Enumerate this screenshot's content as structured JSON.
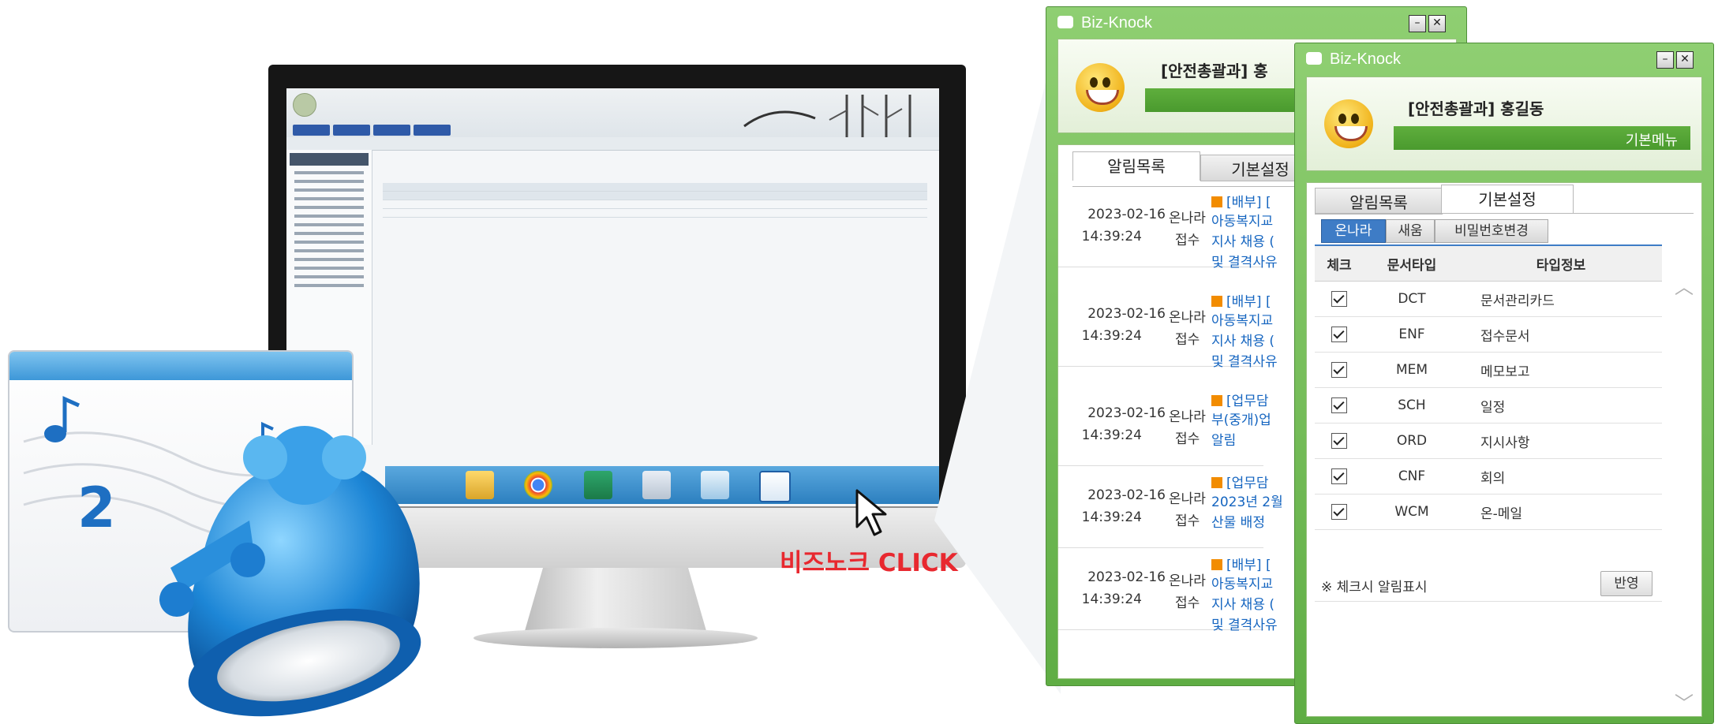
{
  "promo": {
    "click_label": "비즈노크 CLICK"
  },
  "window_back": {
    "title": "Biz-Knock",
    "user": "[안전총괄과] 홍",
    "tabs": [
      "알림목록",
      "기본설정"
    ],
    "notifications": [
      {
        "date": "2023-02-16",
        "time": "14:39:24",
        "source": "온나라",
        "kind": "접수",
        "tag": "[배부] [",
        "lines": [
          "아동복지교",
          "지사 채용 (",
          "및 결격사유"
        ]
      },
      {
        "date": "2023-02-16",
        "time": "14:39:24",
        "source": "온나라",
        "kind": "접수",
        "tag": "[배부] [",
        "lines": [
          "아동복지교",
          "지사 채용 (",
          "및 결격사유"
        ]
      },
      {
        "date": "2023-02-16",
        "time": "14:39:24",
        "source": "온나라",
        "kind": "접수",
        "tag": "[업무담",
        "lines": [
          "부(중개)업",
          "알림"
        ]
      },
      {
        "date": "2023-02-16",
        "time": "14:39:24",
        "source": "온나라",
        "kind": "접수",
        "tag": "[업무담",
        "lines": [
          "2023년 2월",
          "산물 배정"
        ]
      },
      {
        "date": "2023-02-16",
        "time": "14:39:24",
        "source": "온나라",
        "kind": "접수",
        "tag": "[배부] [",
        "lines": [
          "아동복지교",
          "지사 채용 (",
          "및 결격사유"
        ]
      }
    ]
  },
  "window_front": {
    "title": "Biz-Knock",
    "user": "[안전총괄과] 홍길동",
    "menu_label": "기본메뉴",
    "tabs": [
      "알림목록",
      "기본설정"
    ],
    "subtabs": [
      "온나라",
      "새움",
      "비밀번호변경"
    ],
    "columns": [
      "체크",
      "문서타입",
      "타입정보"
    ],
    "rows": [
      {
        "type": "DCT",
        "info": "문서관리카드",
        "checked": true
      },
      {
        "type": "ENF",
        "info": "접수문서",
        "checked": true
      },
      {
        "type": "MEM",
        "info": "메모보고",
        "checked": true
      },
      {
        "type": "SCH",
        "info": "일정",
        "checked": true
      },
      {
        "type": "ORD",
        "info": "지시사항",
        "checked": true
      },
      {
        "type": "CNF",
        "info": "회의",
        "checked": true
      },
      {
        "type": "WCM",
        "info": "온-메일",
        "checked": true
      }
    ],
    "note": "※ 체크시 알림표시",
    "apply_label": "반영"
  }
}
